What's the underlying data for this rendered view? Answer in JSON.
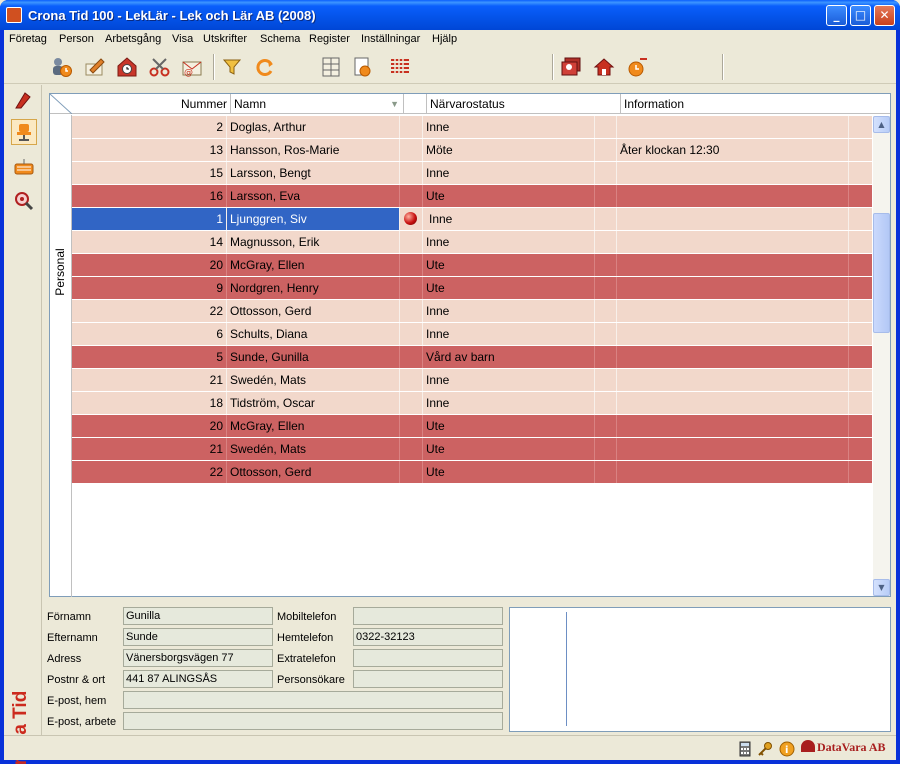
{
  "window": {
    "title": "Crona Tid 100 - LekLär - Lek och Lär AB (2008)"
  },
  "menu": [
    "Företag",
    "Person",
    "Arbetsgång",
    "Visa",
    "Utskrifter",
    "Schema",
    "Register",
    "Inställningar",
    "Hjälp"
  ],
  "sidebar": {
    "brand": "Crona Tid",
    "section_label": "Personal"
  },
  "columns": {
    "number": "Nummer",
    "name": "Namn",
    "status": "Närvarostatus",
    "info": "Information"
  },
  "rows": [
    {
      "number": "2",
      "name": "Doglas, Arthur",
      "status": "Inne",
      "info": "",
      "tone": "light"
    },
    {
      "number": "13",
      "name": "Hansson, Ros-Marie",
      "status": "Möte",
      "info": "Åter klockan 12:30",
      "tone": "light"
    },
    {
      "number": "15",
      "name": "Larsson, Bengt",
      "status": "Inne",
      "info": "",
      "tone": "light"
    },
    {
      "number": "16",
      "name": "Larsson, Eva",
      "status": "Ute",
      "info": "",
      "tone": "dark"
    },
    {
      "number": "1",
      "name": "Ljunggren, Siv",
      "status": "Inne",
      "info": "",
      "tone": "light",
      "selected": true,
      "flag": true
    },
    {
      "number": "14",
      "name": "Magnusson, Erik",
      "status": "Inne",
      "info": "",
      "tone": "light"
    },
    {
      "number": "20",
      "name": "McGray, Ellen",
      "status": "Ute",
      "info": "",
      "tone": "dark"
    },
    {
      "number": "9",
      "name": "Nordgren, Henry",
      "status": "Ute",
      "info": "",
      "tone": "dark"
    },
    {
      "number": "22",
      "name": "Ottosson, Gerd",
      "status": "Inne",
      "info": "",
      "tone": "light"
    },
    {
      "number": "6",
      "name": "Schults, Diana",
      "status": "Inne",
      "info": "",
      "tone": "light"
    },
    {
      "number": "5",
      "name": "Sunde, Gunilla",
      "status": "Vård av barn",
      "info": "",
      "tone": "dark"
    },
    {
      "number": "21",
      "name": "Swedén, Mats",
      "status": "Inne",
      "info": "",
      "tone": "light"
    },
    {
      "number": "18",
      "name": "Tidström, Oscar",
      "status": "Inne",
      "info": "",
      "tone": "light"
    },
    {
      "number": "20",
      "name": "McGray, Ellen",
      "status": "Ute",
      "info": "",
      "tone": "dark"
    },
    {
      "number": "21",
      "name": "Swedén, Mats",
      "status": "Ute",
      "info": "",
      "tone": "dark"
    },
    {
      "number": "22",
      "name": "Ottosson, Gerd",
      "status": "Ute",
      "info": "",
      "tone": "dark"
    }
  ],
  "details": {
    "first_name_label": "Förnamn",
    "first_name": "Gunilla",
    "last_name_label": "Efternamn",
    "last_name": "Sunde",
    "address_label": "Adress",
    "address": "Vänersborgsvägen 77",
    "postal_label": "Postnr & ort",
    "postal": "441 87 ALINGSÅS",
    "email_home_label": "E-post, hem",
    "email_home": "",
    "email_work_label": "E-post, arbete",
    "email_work": "",
    "mobile_label": "Mobiltelefon",
    "mobile": "",
    "home_phone_label": "Hemtelefon",
    "home_phone": "0322-32123",
    "extra_phone_label": "Extratelefon",
    "extra_phone": "",
    "pager_label": "Personsökare",
    "pager": ""
  },
  "statusbar": {
    "logo": "DataVara AB"
  },
  "colors": {
    "row_light": "#f2d8cb",
    "row_dark": "#cc6262",
    "selection": "#3165c5",
    "brand": "#cc2a1e"
  }
}
